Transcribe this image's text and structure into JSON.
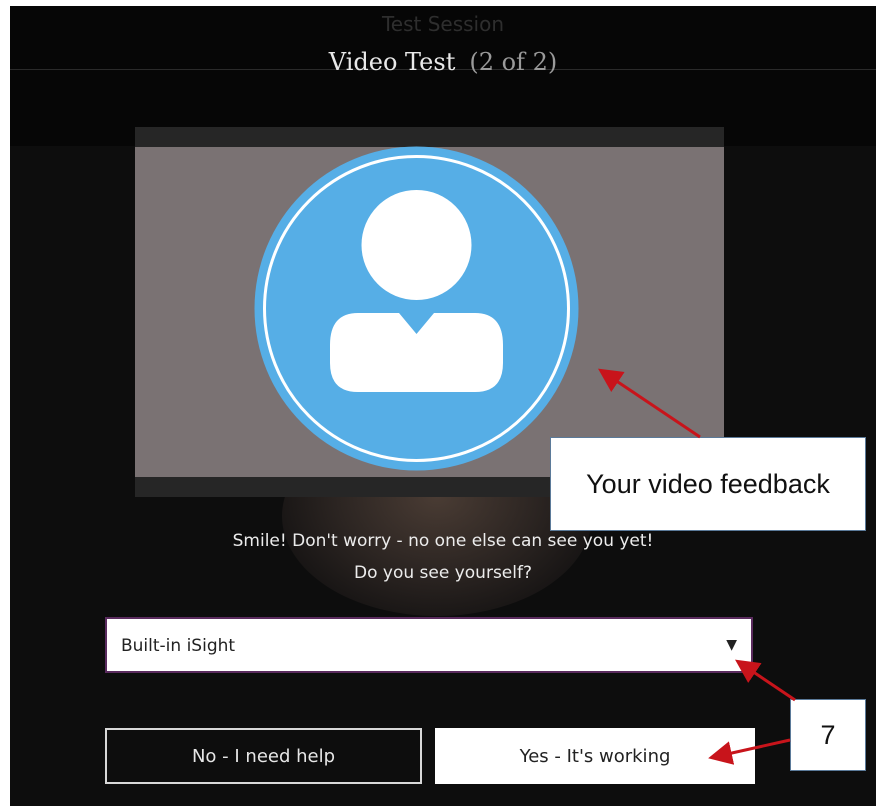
{
  "header": {
    "session_title": "Test Session",
    "video_title": "Video Test",
    "step_label": "(2 of 2)"
  },
  "messages": {
    "line1": "Smile! Don't worry - no one else can see you yet!",
    "line2": "Do you see yourself?"
  },
  "camera_select": {
    "value": "Built-in iSight",
    "arrow": "▼"
  },
  "buttons": {
    "no_label": "No - I need help",
    "yes_label": "Yes - It's working"
  },
  "annotations": {
    "video_feedback": "Your video feedback",
    "step_number": "7"
  },
  "colors": {
    "avatar_blue": "#56aee6",
    "annotation_arrow": "#c8141b",
    "select_border": "#5a2b5e"
  },
  "icons": {
    "avatar": "user-avatar-icon",
    "dropdown": "triangle-down-icon"
  }
}
